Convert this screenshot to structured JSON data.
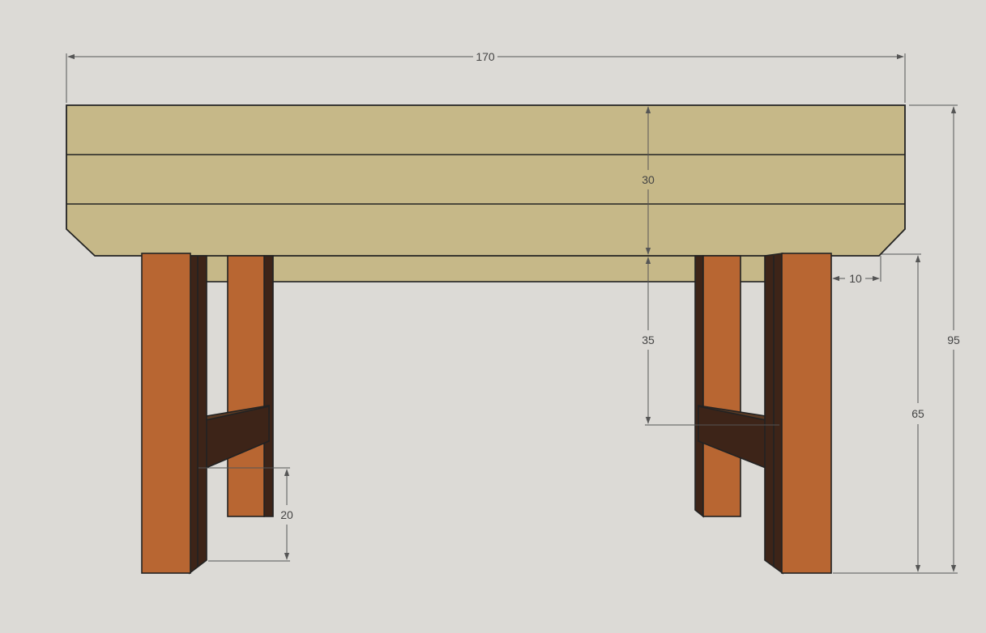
{
  "drawing": {
    "colors": {
      "background": "#dcdad6",
      "top_surface": "#c6b888",
      "leg_front": "#b86632",
      "leg_side": "#3d2418",
      "edge": "#222222",
      "dimension_line": "#555555"
    },
    "dimensions": {
      "overall_width": "170",
      "top_thickness": "30",
      "overall_height": "95",
      "leg_height": "65",
      "stretcher_height": "35",
      "leg_inset": "10",
      "stretcher_gap": "20"
    }
  }
}
